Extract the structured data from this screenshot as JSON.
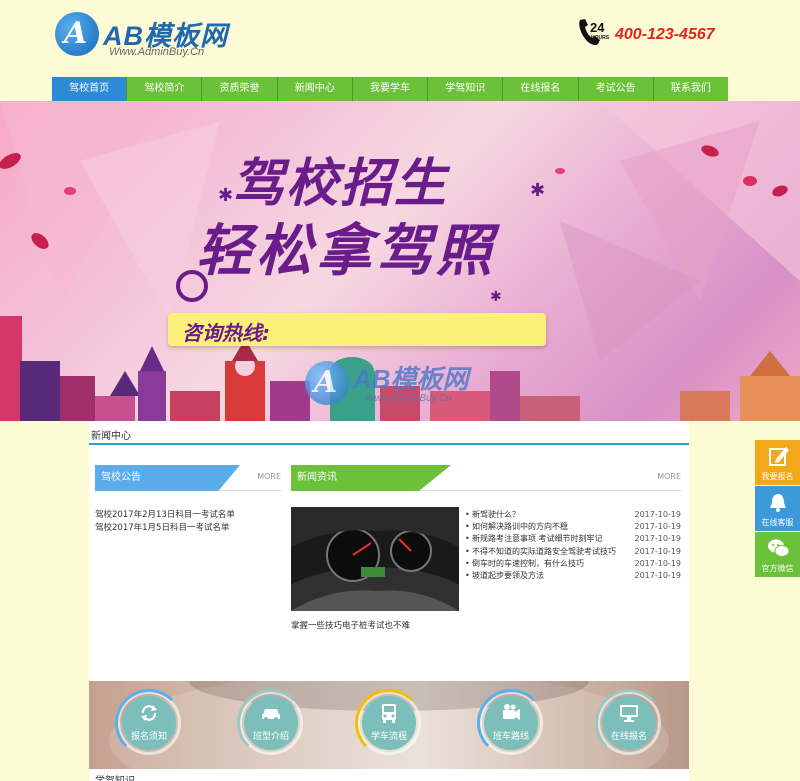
{
  "header": {
    "logo_text": "AB模板网",
    "logo_url": "Www.AdminBuy.Cn",
    "hotline_badge": "24",
    "hotline_badge_sub": "HOURS",
    "phone": "400-123-4567"
  },
  "nav": {
    "items": [
      {
        "label": "驾校首页",
        "active": true
      },
      {
        "label": "驾校简介"
      },
      {
        "label": "资质荣誉"
      },
      {
        "label": "新闻中心"
      },
      {
        "label": "我要学车"
      },
      {
        "label": "学驾知识"
      },
      {
        "label": "在线报名"
      },
      {
        "label": "考试公告"
      },
      {
        "label": "联系我们"
      }
    ]
  },
  "banner": {
    "title_line1": "驾校招生",
    "title_line2": "轻松拿驾照",
    "consult_label": "咨询热线:",
    "watermark_text": "AB模板网",
    "watermark_url": "Www.AdminBuy.Cn"
  },
  "news_center": {
    "title": "新闻中心",
    "notice": {
      "tab": "驾校公告",
      "more": "MORE",
      "items": [
        "驾校2017年2月13日科目一考试名单",
        "驾校2017年1月5日科目一考试名单"
      ]
    },
    "news": {
      "tab": "新闻资讯",
      "more": "MORE",
      "photo_caption": "掌握一些技巧电子桩考试也不难",
      "items": [
        {
          "title": "新驾驶什么？",
          "date": "2017-10-19"
        },
        {
          "title": "如何解决路训中的方向不稳",
          "date": "2017-10-19"
        },
        {
          "title": "新规路考注意事项 考试细节时刻牢记",
          "date": "2017-10-19"
        },
        {
          "title": "不得不知道的实际道路安全驾驶考试技巧",
          "date": "2017-10-19"
        },
        {
          "title": "倒车时的车速控制，有什么技巧",
          "date": "2017-10-19"
        },
        {
          "title": "坡道起步要领及方法",
          "date": "2017-10-19"
        }
      ],
      "pager_active": 2
    }
  },
  "services": [
    {
      "label": "报名须知",
      "icon": "refresh-icon",
      "arc": "#5ab0e8"
    },
    {
      "label": "班型介绍",
      "icon": "car-icon",
      "arc": "#9ac8c4"
    },
    {
      "label": "学车流程",
      "icon": "bus-icon",
      "arc": "#f2c000"
    },
    {
      "label": "班车路线",
      "icon": "camera-icon",
      "arc": "#5ab0e8"
    },
    {
      "label": "在线报名",
      "icon": "monitor-icon",
      "arc": "#9ac8c4"
    }
  ],
  "learn_title": "学驾知识",
  "side_tools": [
    {
      "label": "我要报名",
      "icon": "edit-icon",
      "color": "#f2a818"
    },
    {
      "label": "在线客服",
      "icon": "bell-icon",
      "color": "#3d9ad8"
    },
    {
      "label": "官方微信",
      "icon": "wechat-icon",
      "color": "#6cc13a"
    }
  ],
  "colors": {
    "nav_green": "#6cc13a",
    "nav_active_blue": "#2d8ad6",
    "phone_red": "#e0251b",
    "page_bg": "#fdfbd6"
  }
}
